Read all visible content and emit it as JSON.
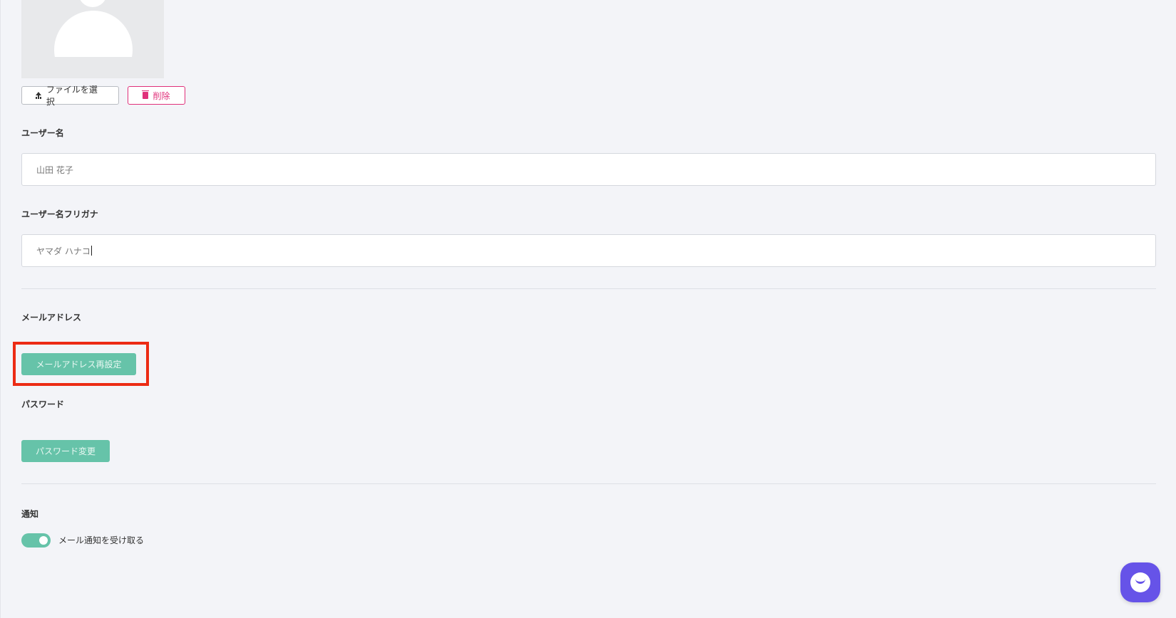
{
  "avatar": {
    "select_file_label": "ファイルを選択",
    "delete_label": "削除"
  },
  "username": {
    "label": "ユーザー名",
    "value": "山田 花子"
  },
  "username_kana": {
    "label": "ユーザー名フリガナ",
    "value": "ヤマダ ハナコ"
  },
  "email": {
    "label": "メールアドレス",
    "reset_button": "メールアドレス再設定"
  },
  "password": {
    "label": "パスワード",
    "change_button": "パスワード変更"
  },
  "notification": {
    "label": "通知",
    "toggle_label": "メール通知を受け取る",
    "toggle_on": true
  },
  "colors": {
    "accent": "#66c3a9",
    "danger": "#e0307a",
    "highlight": "#ec2b14",
    "chat": "#6653e8"
  }
}
